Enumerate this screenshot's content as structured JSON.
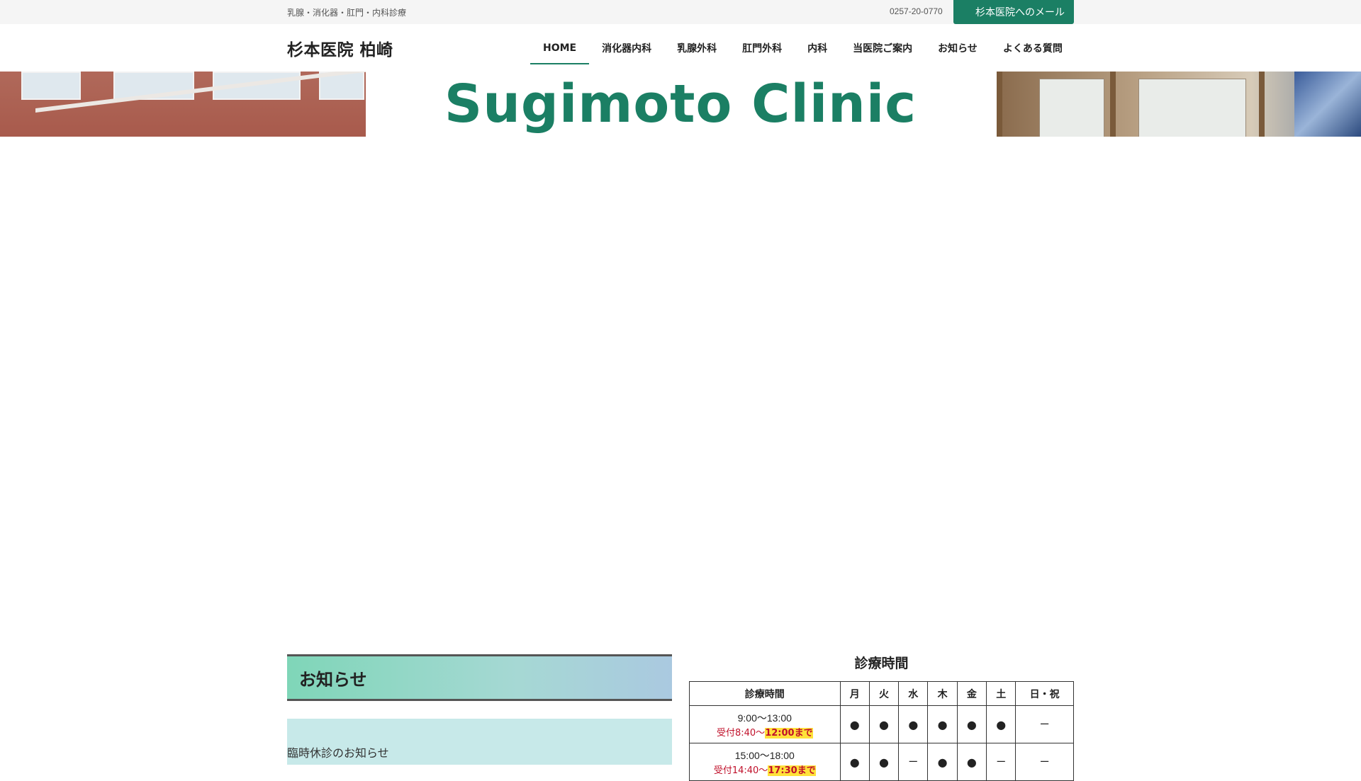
{
  "topbar": {
    "tagline": "乳腺・消化器・肛門・内科診療",
    "phone": "0257-20-0770",
    "mail_button": "杉本医院へのメール"
  },
  "header": {
    "title": "杉本医院 柏崎",
    "nav": [
      {
        "label": "HOME",
        "active": true
      },
      {
        "label": "消化器内科"
      },
      {
        "label": "乳腺外科"
      },
      {
        "label": "肛門外科"
      },
      {
        "label": "内科"
      },
      {
        "label": "当医院ご案内"
      },
      {
        "label": "お知らせ"
      },
      {
        "label": "よくある質問"
      }
    ]
  },
  "hero": {
    "logo_text": "Sugimoto Clinic"
  },
  "news": {
    "heading": "お知らせ",
    "items": [
      "臨時休診のお知らせ"
    ]
  },
  "hours": {
    "title": "診療時間",
    "headers": [
      "診療時間",
      "月",
      "火",
      "水",
      "木",
      "金",
      "土",
      "日・祝"
    ],
    "rows": [
      {
        "time": "9:00～13:00",
        "reception_prefix": "受付8:40～",
        "reception_highlight": "12:00まで",
        "days": [
          "●",
          "●",
          "●",
          "●",
          "●",
          "●",
          "ー"
        ]
      },
      {
        "time": "15:00～18:00",
        "reception_prefix": "受付14:40～",
        "reception_highlight": "17:30まで",
        "days": [
          "●",
          "●",
          "ー",
          "●",
          "●",
          "ー",
          "ー"
        ]
      }
    ]
  },
  "colors": {
    "accent": "#1b7f64",
    "reception_red": "#c0102a",
    "highlight": "#ffe23a"
  }
}
